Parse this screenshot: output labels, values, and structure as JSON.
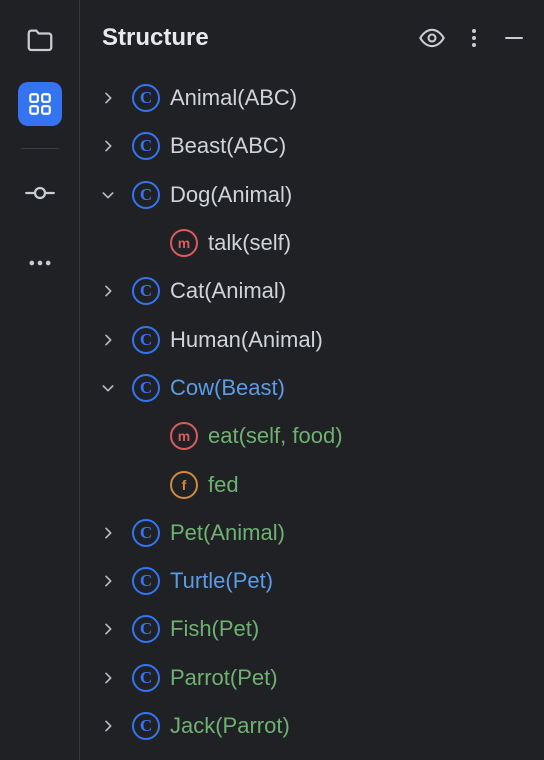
{
  "panel": {
    "title": "Structure"
  },
  "sidebar": {
    "items": [
      {
        "name": "project-tool-icon",
        "active": false
      },
      {
        "name": "structure-tool-icon",
        "active": true
      },
      {
        "name": "commit-tool-icon",
        "active": false
      },
      {
        "name": "more-tool-icon",
        "active": false
      }
    ]
  },
  "tree": [
    {
      "indent": 0,
      "chevron": "right",
      "badge": "class",
      "badgeLetter": "C",
      "label": "Animal(ABC)",
      "color": "default"
    },
    {
      "indent": 0,
      "chevron": "right",
      "badge": "class",
      "badgeLetter": "C",
      "label": "Beast(ABC)",
      "color": "default"
    },
    {
      "indent": 0,
      "chevron": "down",
      "badge": "class",
      "badgeLetter": "C",
      "label": "Dog(Animal)",
      "color": "default"
    },
    {
      "indent": 1,
      "chevron": "none",
      "badge": "method",
      "badgeLetter": "m",
      "label": "talk(self)",
      "color": "default"
    },
    {
      "indent": 0,
      "chevron": "right",
      "badge": "class",
      "badgeLetter": "C",
      "label": "Cat(Animal)",
      "color": "default"
    },
    {
      "indent": 0,
      "chevron": "right",
      "badge": "class",
      "badgeLetter": "C",
      "label": "Human(Animal)",
      "color": "default"
    },
    {
      "indent": 0,
      "chevron": "down",
      "badge": "class",
      "badgeLetter": "C",
      "label": "Cow(Beast)",
      "color": "blue"
    },
    {
      "indent": 1,
      "chevron": "none",
      "badge": "method",
      "badgeLetter": "m",
      "label": "eat(self, food)",
      "color": "green"
    },
    {
      "indent": 1,
      "chevron": "none",
      "badge": "field",
      "badgeLetter": "f",
      "label": "fed",
      "color": "green"
    },
    {
      "indent": 0,
      "chevron": "right",
      "badge": "class",
      "badgeLetter": "C",
      "label": "Pet(Animal)",
      "color": "green"
    },
    {
      "indent": 0,
      "chevron": "right",
      "badge": "class",
      "badgeLetter": "C",
      "label": "Turtle(Pet)",
      "color": "blue"
    },
    {
      "indent": 0,
      "chevron": "right",
      "badge": "class",
      "badgeLetter": "C",
      "label": "Fish(Pet)",
      "color": "green"
    },
    {
      "indent": 0,
      "chevron": "right",
      "badge": "class",
      "badgeLetter": "C",
      "label": "Parrot(Pet)",
      "color": "green"
    },
    {
      "indent": 0,
      "chevron": "right",
      "badge": "class",
      "badgeLetter": "C",
      "label": "Jack(Parrot)",
      "color": "green"
    }
  ]
}
